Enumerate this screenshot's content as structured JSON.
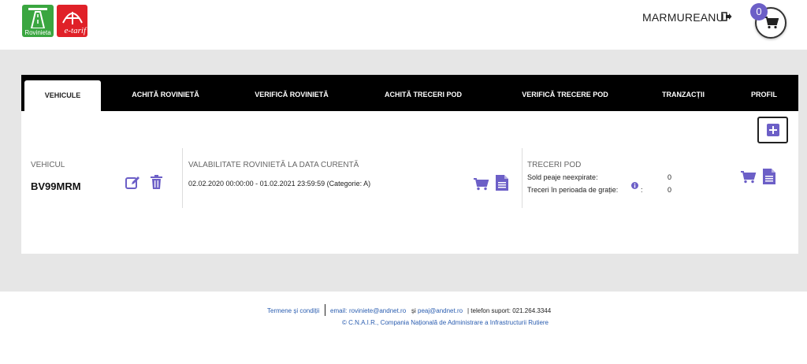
{
  "header": {
    "logo_rovinieta": "Rovinieta",
    "logo_etarif": "e-tarif",
    "username": "MARMUREANU",
    "cart_count": "0"
  },
  "tabs": [
    {
      "label": "VEHICULE"
    },
    {
      "label": "ACHITĂ ROVINIETĂ"
    },
    {
      "label": "VERIFICĂ ROVINIETĂ"
    },
    {
      "label": "ACHITĂ TRECERI POD"
    },
    {
      "label": "VERIFICĂ TRECERE POD"
    },
    {
      "label": "TRANZACȚII"
    },
    {
      "label": "PROFIL"
    }
  ],
  "vehicle": {
    "col_label": "VEHICUL",
    "plate": "BV99MRM"
  },
  "validity": {
    "col_label": "VALABILITATE ROVINIETĂ LA DATA CURENTĂ",
    "value": "02.02.2020 00:00:00 - 01.02.2021 23:59:59 (Categorie: A)"
  },
  "bridge": {
    "col_label": "TRECERI POD",
    "sold_label": "Sold peaje neexpirate:",
    "sold_value": "0",
    "grace_label": "Treceri în perioada de grație:",
    "grace_suffix": ":",
    "grace_value": "0"
  },
  "footer": {
    "terms": "Termene și condiții",
    "email_label": "email:",
    "email1": "roviniete@andnet.ro",
    "and": "și",
    "email2": "peaj@andnet.ro",
    "phone": "| telefon suport: 021.264.3344",
    "copyright": "© C.N.A.I.R., Compania Națională de Administrare a Infrastructurii Rutiere"
  },
  "colors": {
    "accent": "#6c5fc7",
    "tabbar": "#000000",
    "band": "#e6e6e6",
    "link": "#2a5db0"
  }
}
